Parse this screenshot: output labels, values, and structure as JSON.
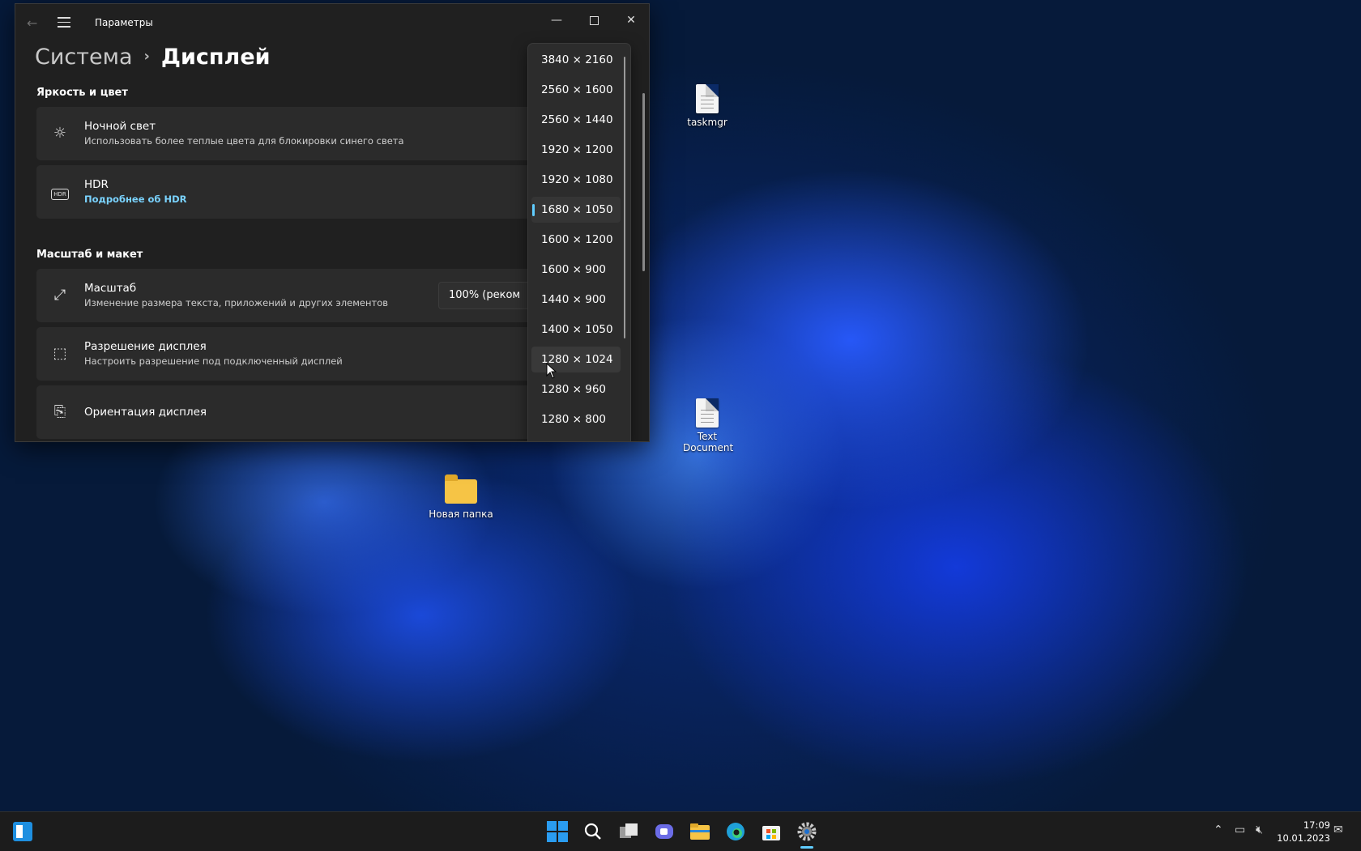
{
  "window": {
    "title": "Параметры",
    "breadcrumb_parent": "Система",
    "breadcrumb_current": "Дисплей"
  },
  "sections": {
    "brightness": "Яркость и цвет",
    "scale_layout": "Масштаб и макет"
  },
  "cards": {
    "night_light": {
      "title": "Ночной свет",
      "subtitle": "Использовать более теплые цвета для блокировки синего света"
    },
    "hdr": {
      "title": "HDR",
      "link": "Подробнее об HDR"
    },
    "scale": {
      "title": "Масштаб",
      "subtitle": "Изменение размера текста, приложений и других элементов",
      "value": "100% (реком"
    },
    "resolution": {
      "title": "Разрешение дисплея",
      "subtitle": "Настроить разрешение под подключенный дисплей"
    },
    "orientation": {
      "title": "Ориентация дисплея"
    }
  },
  "resolution_dropdown": {
    "options": [
      "3840 × 2160",
      "2560 × 1600",
      "2560 × 1440",
      "1920 × 1200",
      "1920 × 1080",
      "1680 × 1050",
      "1600 × 1200",
      "1600 × 900",
      "1440 × 900",
      "1400 × 1050",
      "1280 × 1024",
      "1280 × 960",
      "1280 × 800"
    ],
    "selected": "1680 × 1050",
    "hovered": "1280 × 1024"
  },
  "desktop": {
    "icons": [
      {
        "label": "taskmgr",
        "icon": "document-icon"
      },
      {
        "label": "Text Document",
        "icon": "document-icon"
      },
      {
        "label": "Новая папка",
        "icon": "folder-icon"
      }
    ]
  },
  "taskbar": {
    "time": "17:09",
    "date": "10.01.2023",
    "pinned": [
      "start-icon",
      "search-icon",
      "task-view-icon",
      "chat-icon",
      "file-explorer-icon",
      "edge-icon",
      "store-icon",
      "settings-icon"
    ],
    "accent": "#60cdff"
  }
}
